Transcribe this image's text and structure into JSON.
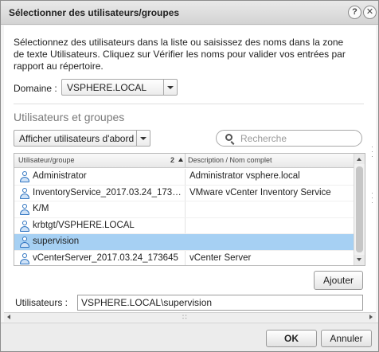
{
  "dialog": {
    "title": "Sélectionner des utilisateurs/groupes",
    "help_label": "?",
    "close_label": "✕"
  },
  "instructions": "Sélectionnez des utilisateurs dans la liste ou saisissez des noms dans la zone de texte Utilisateurs. Cliquez sur Vérifier les noms pour valider vos entrées par rapport au répertoire.",
  "domain": {
    "label": "Domaine :",
    "value": "VSPHERE.LOCAL"
  },
  "section": {
    "title": "Utilisateurs et groupes"
  },
  "show_filter": {
    "value": "Afficher utilisateurs d'abord"
  },
  "search": {
    "placeholder": "Recherche"
  },
  "table": {
    "columns": {
      "user_group": "Utilisateur/groupe",
      "sort_indicator": "2",
      "description": "Description / Nom complet"
    },
    "rows": [
      {
        "name": "Administrator",
        "description": "Administrator vsphere.local",
        "icon": "user-icon",
        "selected": false
      },
      {
        "name": "InventoryService_2017.03.24_1733...",
        "description": "VMware vCenter Inventory Service",
        "icon": "user-icon",
        "selected": false
      },
      {
        "name": "K/M",
        "description": "",
        "icon": "user-icon",
        "selected": false
      },
      {
        "name": "krbtgt/VSPHERE.LOCAL",
        "description": "",
        "icon": "user-icon",
        "selected": false
      },
      {
        "name": "supervision",
        "description": "",
        "icon": "user-icon",
        "selected": true
      },
      {
        "name": "vCenterServer_2017.03.24_173645",
        "description": "vCenter Server",
        "icon": "user-icon",
        "selected": false
      }
    ]
  },
  "add_button": "Ajouter",
  "users": {
    "label": "Utilisateurs :",
    "value": "VSPHERE.LOCAL\\supervision"
  },
  "footer": {
    "ok_label": "OK",
    "cancel_label": "Annuler"
  },
  "colors": {
    "selected_row": "#a6d0f3",
    "user_icon": "#2f74c0"
  }
}
